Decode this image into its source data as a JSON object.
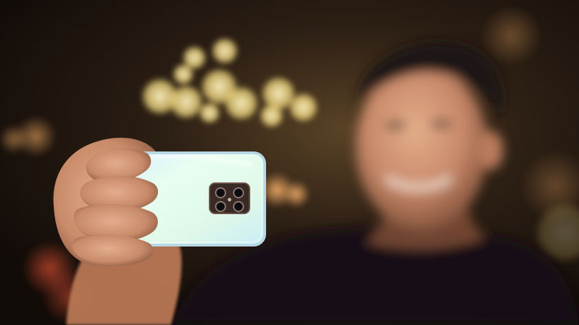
{
  "scene": {
    "description_colors": {
      "background_dark": "#1a120c",
      "bokeh_warm": "#f6e08a",
      "bokeh_red": "#c0392b",
      "shirt": "#141010",
      "skin": "#c98a6a",
      "phone_body": "#d9f3e6",
      "phone_edge": "#b9d8e6",
      "camera_module": "#3a2a26"
    },
    "icons": {
      "camera": "camera-lens-icon",
      "flash": "flash-icon"
    }
  }
}
